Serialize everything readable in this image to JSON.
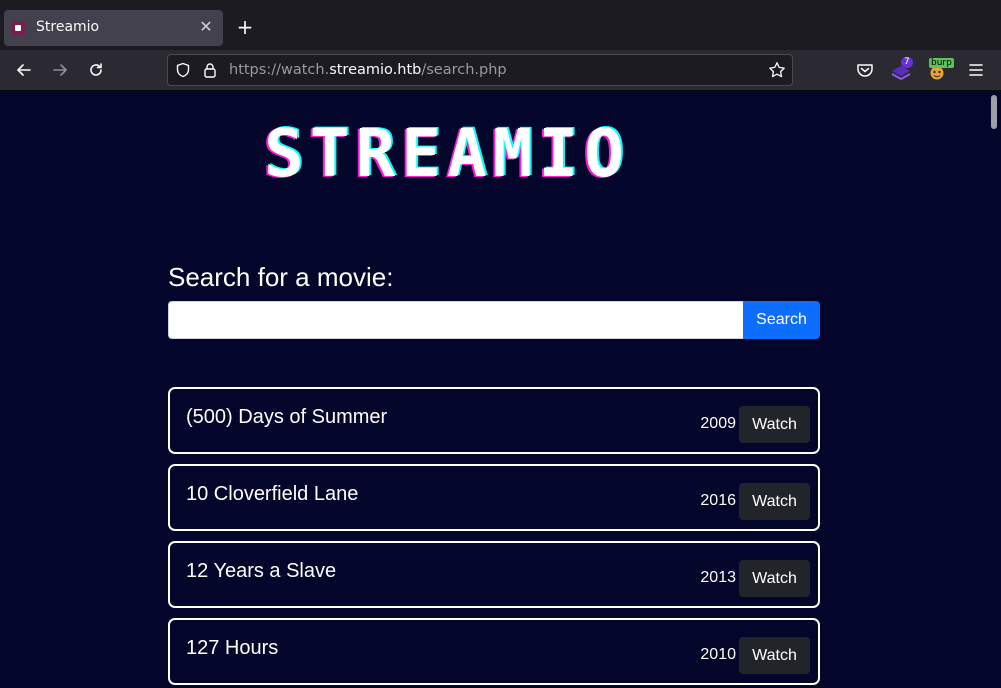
{
  "browser": {
    "tab_title": "Streamio",
    "url_scheme": "https://watch.",
    "url_host": "streamio.htb",
    "url_path": "/search.php",
    "extension_badge": "7",
    "burp_label": "burp"
  },
  "page": {
    "logo_text": "STREAMIO",
    "search_label": "Search for a movie:",
    "search_value": "",
    "search_button": "Search",
    "watch_label": "Watch",
    "movies": [
      {
        "title": "(500) Days of Summer",
        "year": "2009"
      },
      {
        "title": "10 Cloverfield Lane",
        "year": "2016"
      },
      {
        "title": "12 Years a Slave",
        "year": "2013"
      },
      {
        "title": "127 Hours",
        "year": "2010"
      }
    ]
  },
  "colors": {
    "page_bg": "#03052b",
    "search_button": "#0d6efd",
    "watch_button": "#212529",
    "logo_shadow_magenta": "#ff1ad9",
    "logo_shadow_cyan": "#00ffff"
  }
}
